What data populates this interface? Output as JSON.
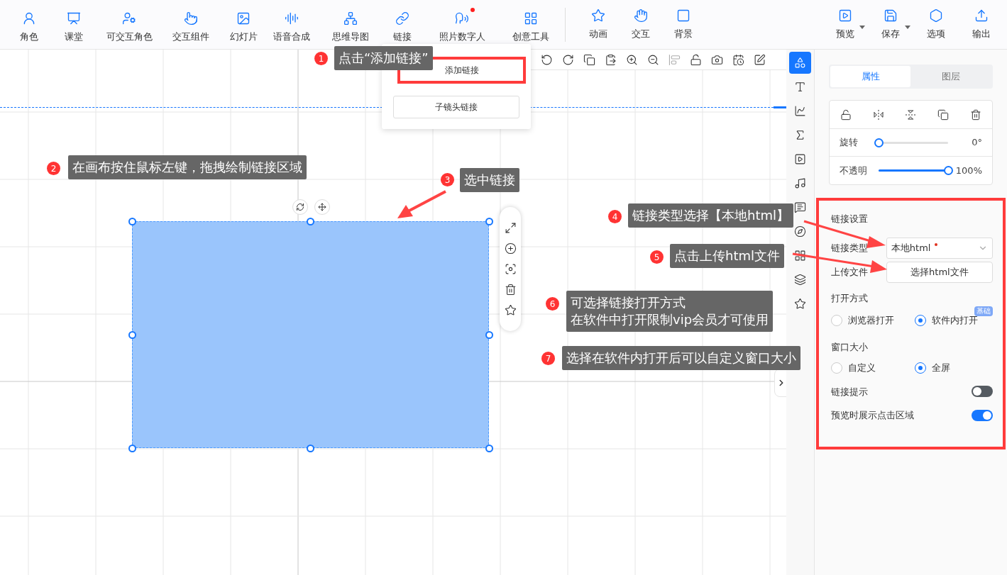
{
  "toolbar": {
    "items": [
      {
        "label": "角色",
        "dot": false
      },
      {
        "label": "课堂",
        "dot": false
      },
      {
        "label": "可交互角色",
        "dot": false
      },
      {
        "label": "交互组件",
        "dot": false
      },
      {
        "label": "幻灯片",
        "dot": false
      },
      {
        "label": "语音合成",
        "dot": false
      },
      {
        "label": "思维导图",
        "dot": false
      },
      {
        "label": "链接",
        "dot": false
      },
      {
        "label": "照片数字人",
        "dot": true
      },
      {
        "label": "创意工具",
        "dot": false
      }
    ],
    "effects": [
      {
        "label": "动画"
      },
      {
        "label": "交互"
      },
      {
        "label": "背景"
      }
    ],
    "actions": [
      {
        "label": "预览",
        "dropdown": true
      },
      {
        "label": "保存",
        "dropdown": true
      },
      {
        "label": "选项",
        "dropdown": false
      },
      {
        "label": "输出",
        "dropdown": false
      }
    ]
  },
  "link_menu": {
    "items": [
      "添加链接",
      "子镜头链接"
    ]
  },
  "side_rail": {
    "items": [
      {
        "kind": "shapes",
        "selected": true
      },
      {
        "kind": "text",
        "selected": false
      },
      {
        "kind": "chart",
        "selected": false
      },
      {
        "kind": "formula",
        "selected": false
      },
      {
        "kind": "video",
        "selected": false
      },
      {
        "kind": "music",
        "selected": false
      },
      {
        "kind": "comment",
        "selected": false
      },
      {
        "kind": "compass",
        "selected": false
      },
      {
        "kind": "widgets",
        "selected": false
      },
      {
        "kind": "layers",
        "selected": false
      },
      {
        "kind": "star",
        "selected": false
      }
    ]
  },
  "properties_panel": {
    "tabs": [
      {
        "label": "属性",
        "selected": true
      },
      {
        "label": "图层",
        "selected": false
      }
    ],
    "sliders": [
      {
        "label": "旋转",
        "level": 0,
        "reading": "0°"
      },
      {
        "label": "不透明",
        "level": 1,
        "reading": "100%"
      }
    ]
  },
  "link_settings": {
    "title": "链接设置",
    "link_type": {
      "label": "链接类型",
      "value": "本地html",
      "required": true
    },
    "upload": {
      "label": "上传文件",
      "button": "选择html文件"
    },
    "open_mode": {
      "label": "打开方式",
      "badge": "基础",
      "options": [
        {
          "label": "浏览器打开",
          "selected": false
        },
        {
          "label": "软件内打开",
          "selected": true
        }
      ]
    },
    "window_size": {
      "label": "窗口大小",
      "options": [
        {
          "label": "自定义",
          "selected": false
        },
        {
          "label": "全屏",
          "selected": true
        }
      ]
    },
    "toggles": [
      {
        "label": "链接提示",
        "on": false
      },
      {
        "label": "预览时展示点击区域",
        "on": true
      }
    ]
  },
  "annotations": [
    {
      "number": "1",
      "lines": [
        "点击“添加链接”"
      ]
    },
    {
      "number": "2",
      "lines": [
        "在画布按住鼠标左键，拖拽绘制链接区域"
      ]
    },
    {
      "number": "3",
      "lines": [
        "选中链接"
      ]
    },
    {
      "number": "4",
      "lines": [
        "链接类型选择【本地html】"
      ]
    },
    {
      "number": "5",
      "lines": [
        "点击上传html文件"
      ]
    },
    {
      "number": "6",
      "lines": [
        "可选择链接打开方式",
        "在软件中打开限制vip会员才可使用"
      ]
    },
    {
      "number": "7",
      "lines": [
        "选择在软件内打开后可以自定义窗口大小"
      ]
    }
  ]
}
